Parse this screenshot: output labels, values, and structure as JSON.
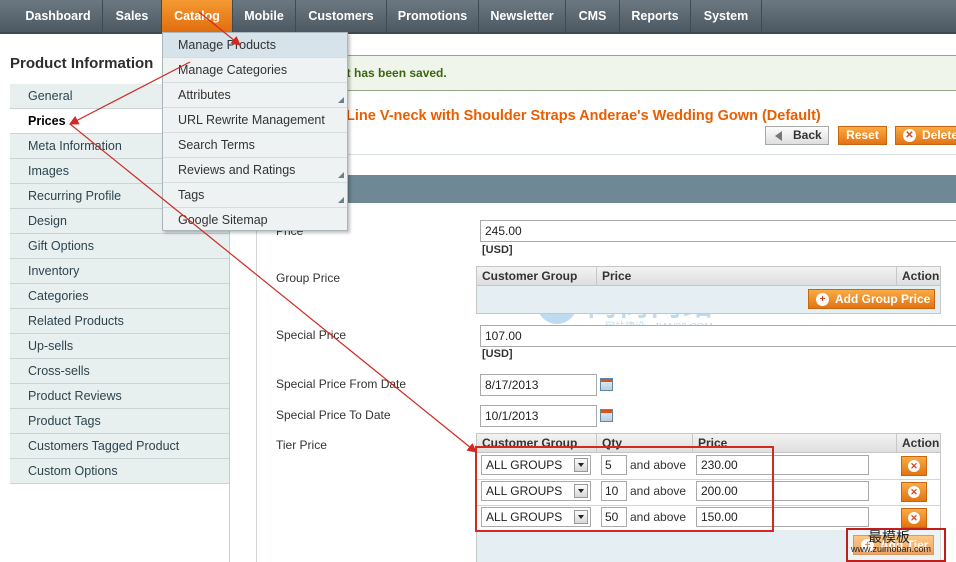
{
  "nav": {
    "items": [
      "Dashboard",
      "Sales",
      "Catalog",
      "Mobile",
      "Customers",
      "Promotions",
      "Newsletter",
      "CMS",
      "Reports",
      "System"
    ],
    "active": "Catalog"
  },
  "catalog_menu": {
    "items": [
      "Manage Products",
      "Manage Categories",
      "Attributes",
      "URL Rewrite Management",
      "Search Terms",
      "Reviews and Ratings",
      "Tags",
      "Google Sitemap"
    ]
  },
  "sidebar": {
    "title": "Product Information",
    "tabs": [
      "General",
      "Prices",
      "Meta Information",
      "Images",
      "Recurring Profile",
      "Design",
      "Gift Options",
      "Inventory",
      "Categories",
      "Related Products",
      "Up-sells",
      "Cross-sells",
      "Product Reviews",
      "Product Tags",
      "Customers Tagged Product",
      "Custom Options"
    ],
    "active": "Prices"
  },
  "message": {
    "success": "ct has been saved."
  },
  "product": {
    "title": "Line V-neck with Shoulder Straps Anderae's Wedding Gown (Default)"
  },
  "actions": {
    "back": "Back",
    "reset": "Reset",
    "delete": "Delete"
  },
  "form": {
    "price_label": "Price",
    "price_value": "245.00",
    "currency_note": "[USD]",
    "group_price_label": "Group Price",
    "group_price_headers": {
      "customer_group": "Customer Group",
      "price": "Price",
      "action": "Action"
    },
    "add_group_price": "Add Group Price",
    "special_price_label": "Special Price",
    "special_price_value": "107.00",
    "special_from_label": "Special Price From Date",
    "special_from_value": "8/17/2013",
    "special_to_label": "Special Price To Date",
    "special_to_value": "10/1/2013",
    "tier_price_label": "Tier Price",
    "tier_headers": {
      "customer_group": "Customer Group",
      "qty": "Qty",
      "price": "Price",
      "action": "Action"
    },
    "tier_rows": [
      {
        "group": "ALL GROUPS",
        "qty": "5",
        "and_above": "and above",
        "price": "230.00"
      },
      {
        "group": "ALL GROUPS",
        "qty": "10",
        "and_above": "and above",
        "price": "200.00"
      },
      {
        "group": "ALL GROUPS",
        "qty": "50",
        "and_above": "and above",
        "price": "150.00"
      }
    ],
    "add_tier": "Add Tier"
  },
  "watermarks": {
    "center_cn": "简尚网络",
    "center_en": "网站建设 · JIAN33.COM",
    "corner_cn": "最模板",
    "corner_url": "www.zuimoban.com"
  },
  "colors": {
    "nav_active": "#e9801f",
    "title_orange": "#eb5e00",
    "annotation_red": "#d12a22",
    "section_bar": "#6f8895"
  }
}
